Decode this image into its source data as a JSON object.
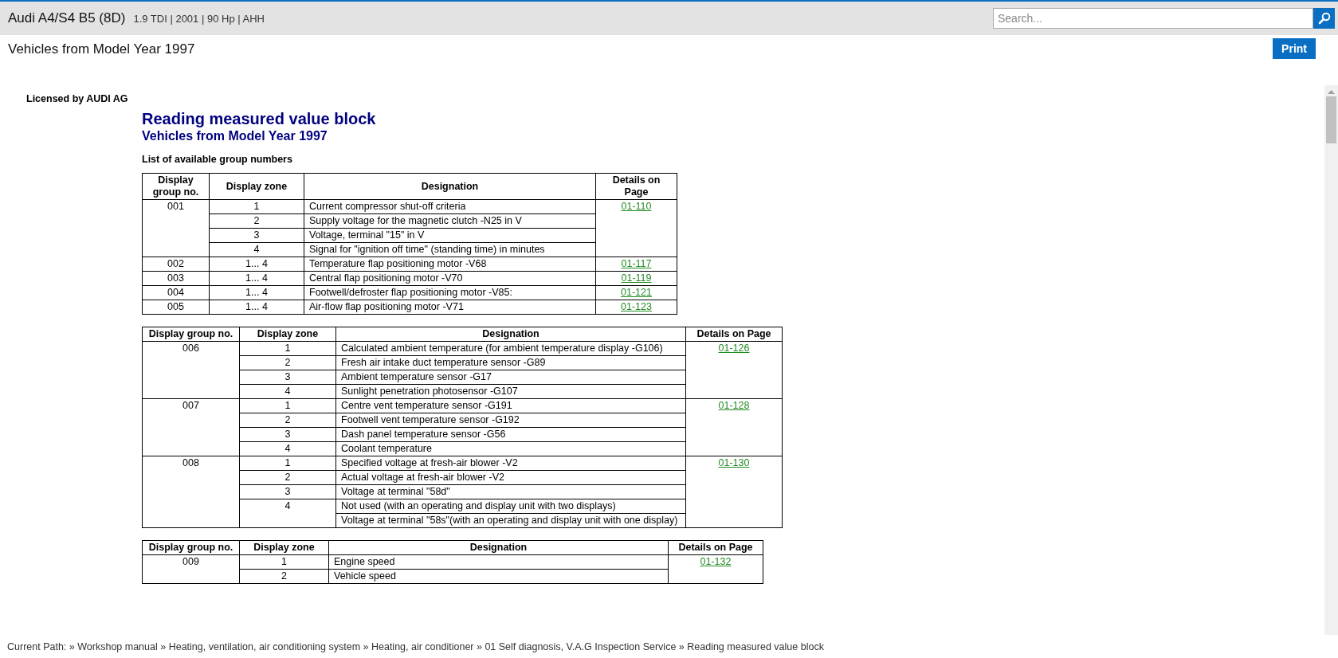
{
  "header": {
    "title": "Audi A4/S4 B5 (8D)",
    "subtitle": "1.9 TDI | 2001 | 90 Hp | AHH",
    "search": {
      "placeholder": "Search..."
    }
  },
  "page_title": "Vehicles from Model Year 1997",
  "print_button": "Print",
  "document": {
    "license": "Licensed by AUDI AG",
    "heading": "Reading measured value block",
    "subheading": "Vehicles from Model Year 1997",
    "intro": "List of available group numbers",
    "tables": [
      {
        "columns": [
          "Display group no.",
          "Display zone",
          "Designation",
          "Details on Page"
        ],
        "groups": [
          {
            "group": "001",
            "page": "01-110",
            "zones": [
              {
                "zone": "1",
                "designations": [
                  "Current compressor shut-off criteria"
                ]
              },
              {
                "zone": "2",
                "designations": [
                  "Supply voltage for the magnetic clutch -N25 in V"
                ]
              },
              {
                "zone": "3",
                "designations": [
                  "Voltage, terminal \"15\" in V"
                ]
              },
              {
                "zone": "4",
                "designations": [
                  "Signal for \"ignition off time\" (standing time) in minutes"
                ]
              }
            ]
          },
          {
            "group": "002",
            "page": "01-117",
            "zones": [
              {
                "zone": "1... 4",
                "designations": [
                  "Temperature flap positioning motor -V68"
                ]
              }
            ]
          },
          {
            "group": "003",
            "page": "01-119",
            "zones": [
              {
                "zone": "1... 4",
                "designations": [
                  "Central flap positioning motor -V70"
                ]
              }
            ]
          },
          {
            "group": "004",
            "page": "01-121",
            "zones": [
              {
                "zone": "1... 4",
                "designations": [
                  "Footwell/defroster flap positioning motor -V85:"
                ]
              }
            ]
          },
          {
            "group": "005",
            "page": "01-123",
            "zones": [
              {
                "zone": "1... 4",
                "designations": [
                  "Air-flow flap positioning motor -V71"
                ]
              }
            ]
          }
        ]
      },
      {
        "columns": [
          "Display group no.",
          "Display zone",
          "Designation",
          "Details on Page"
        ],
        "groups": [
          {
            "group": "006",
            "page": "01-126",
            "zones": [
              {
                "zone": "1",
                "designations": [
                  "Calculated ambient temperature (for ambient temperature display -G106)"
                ]
              },
              {
                "zone": "2",
                "designations": [
                  "Fresh air intake duct temperature sensor -G89"
                ]
              },
              {
                "zone": "3",
                "designations": [
                  "Ambient temperature sensor -G17"
                ]
              },
              {
                "zone": "4",
                "designations": [
                  "Sunlight penetration photosensor -G107"
                ]
              }
            ]
          },
          {
            "group": "007",
            "page": "01-128",
            "zones": [
              {
                "zone": "1",
                "designations": [
                  "Centre vent temperature sensor -G191"
                ]
              },
              {
                "zone": "2",
                "designations": [
                  "Footwell vent temperature sensor -G192"
                ]
              },
              {
                "zone": "3",
                "designations": [
                  "Dash panel temperature sensor -G56"
                ]
              },
              {
                "zone": "4",
                "designations": [
                  "Coolant temperature"
                ]
              }
            ]
          },
          {
            "group": "008",
            "page": "01-130",
            "zones": [
              {
                "zone": "1",
                "designations": [
                  "Specified voltage at fresh-air blower -V2"
                ]
              },
              {
                "zone": "2",
                "designations": [
                  "Actual voltage at fresh-air blower -V2"
                ]
              },
              {
                "zone": "3",
                "designations": [
                  "Voltage at terminal \"58d\""
                ]
              },
              {
                "zone": "4",
                "designations": [
                  "Not used (with an operating and display unit with two displays)",
                  "Voltage at terminal \"58s\"(with an operating and display unit with one display)"
                ]
              }
            ]
          }
        ]
      },
      {
        "columns": [
          "Display group no.",
          "Display zone",
          "Designation",
          "Details on Page"
        ],
        "groups": [
          {
            "group": "009",
            "page": "01-132",
            "zones": [
              {
                "zone": "1",
                "designations": [
                  "Engine speed"
                ]
              },
              {
                "zone": "2",
                "designations": [
                  "Vehicle speed"
                ]
              }
            ]
          }
        ]
      }
    ]
  },
  "breadcrumb": "Current Path: » Workshop manual » Heating, ventilation, air conditioning system » Heating, air conditioner » 01 Self diagnosis, V.A.G Inspection Service » Reading measured value block"
}
